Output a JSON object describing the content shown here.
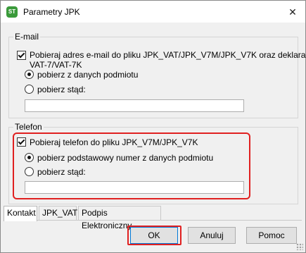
{
  "window": {
    "title": "Parametry JPK",
    "app_icon": "app-logo-icon",
    "close_icon": "close-icon"
  },
  "email_group": {
    "legend": "E-mail",
    "checkbox_label_line1": "Pobieraj adres e-mail do pliku JPK_VAT/JPK_V7M/JPK_V7K oraz deklaracji",
    "checkbox_label_line2": "VAT-7/VAT-7K",
    "checkbox_checked": true,
    "radio_from_entity": "pobierz z danych podmiotu",
    "radio_from_here": "pobierz stąd:",
    "selected_radio": "from_entity",
    "field_value": ""
  },
  "phone_group": {
    "legend": "Telefon",
    "checkbox_label": "Pobieraj telefon do pliku JPK_V7M/JPK_V7K",
    "checkbox_checked": true,
    "radio_primary": "pobierz podstawowy numer z danych podmiotu",
    "radio_from_here": "pobierz stąd:",
    "selected_radio": "primary",
    "field_value": ""
  },
  "tabs": [
    {
      "label": "Kontakt",
      "active": true
    },
    {
      "label": "JPK_VAT",
      "active": false
    },
    {
      "label": "Podpis Elektroniczny",
      "active": false
    }
  ],
  "buttons": {
    "ok": "OK",
    "cancel": "Anuluj",
    "help": "Pomoc"
  },
  "colors": {
    "highlight": "#e02020",
    "dialog_bg": "#f0f0f0"
  }
}
